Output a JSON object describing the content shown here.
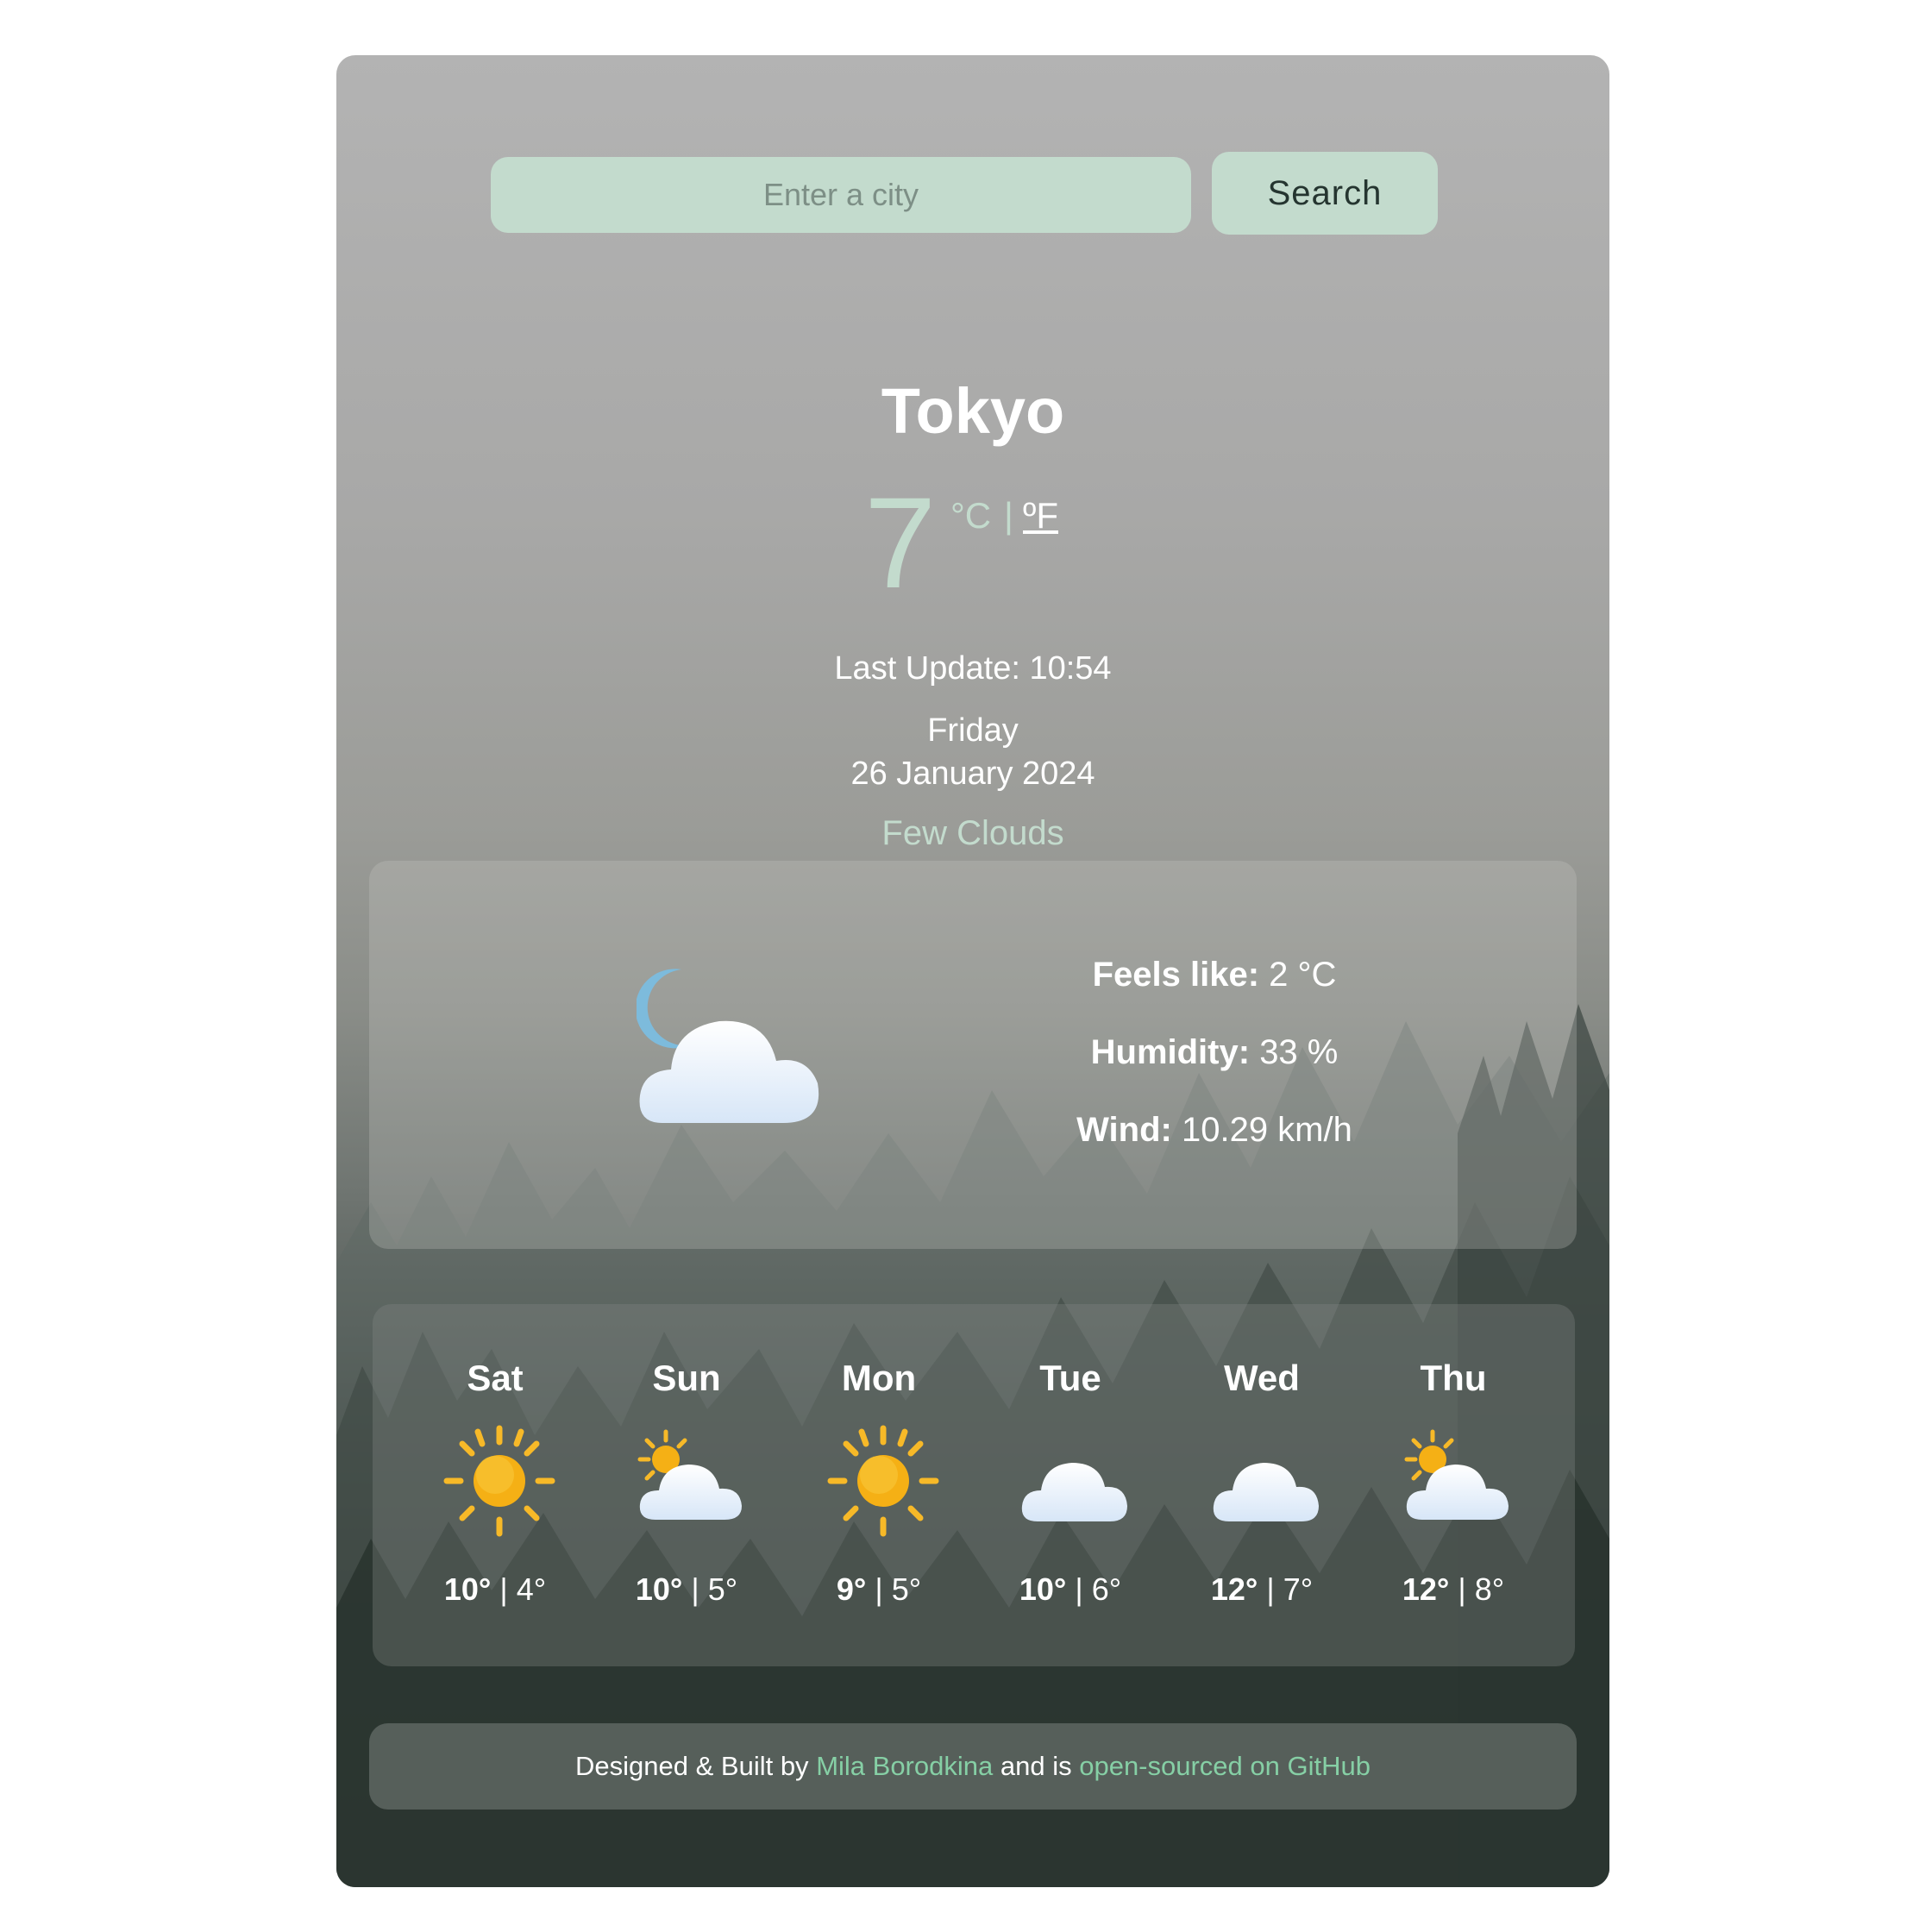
{
  "search": {
    "placeholder": "Enter a city",
    "button_label": "Search"
  },
  "current": {
    "city": "Tokyo",
    "temperature": "7",
    "unit_c": "°C",
    "unit_separator": "|",
    "unit_f": "ºF",
    "last_update": "Last Update: 10:54",
    "day": "Friday",
    "date": "26 January 2024",
    "description": "Few Clouds",
    "icon": "few-clouds-night-icon"
  },
  "details": {
    "feels_like_label": "Feels like:",
    "feels_like_value": "2 °C",
    "humidity_label": "Humidity:",
    "humidity_value": "33 %",
    "wind_label": "Wind:",
    "wind_value": "10.29 km/h"
  },
  "forecast": [
    {
      "day": "Sat",
      "high": "10°",
      "low": "4°",
      "icon": "sun-icon"
    },
    {
      "day": "Sun",
      "high": "10°",
      "low": "5°",
      "icon": "partly-cloudy-icon"
    },
    {
      "day": "Mon",
      "high": "9°",
      "low": "5°",
      "icon": "sun-icon"
    },
    {
      "day": "Tue",
      "high": "10°",
      "low": "6°",
      "icon": "cloud-icon"
    },
    {
      "day": "Wed",
      "high": "12°",
      "low": "7°",
      "icon": "cloud-icon"
    },
    {
      "day": "Thu",
      "high": "12°",
      "low": "8°",
      "icon": "partly-cloudy-icon"
    }
  ],
  "temp_separator": "|",
  "footer": {
    "prefix": "Designed & Built by",
    "author": "Mila Borodkina",
    "middle": "and is",
    "repo_link": "open-sourced on GitHub"
  },
  "colors": {
    "accent": "#c3dbcd",
    "link": "#86cfa5",
    "text": "#ffffff"
  }
}
